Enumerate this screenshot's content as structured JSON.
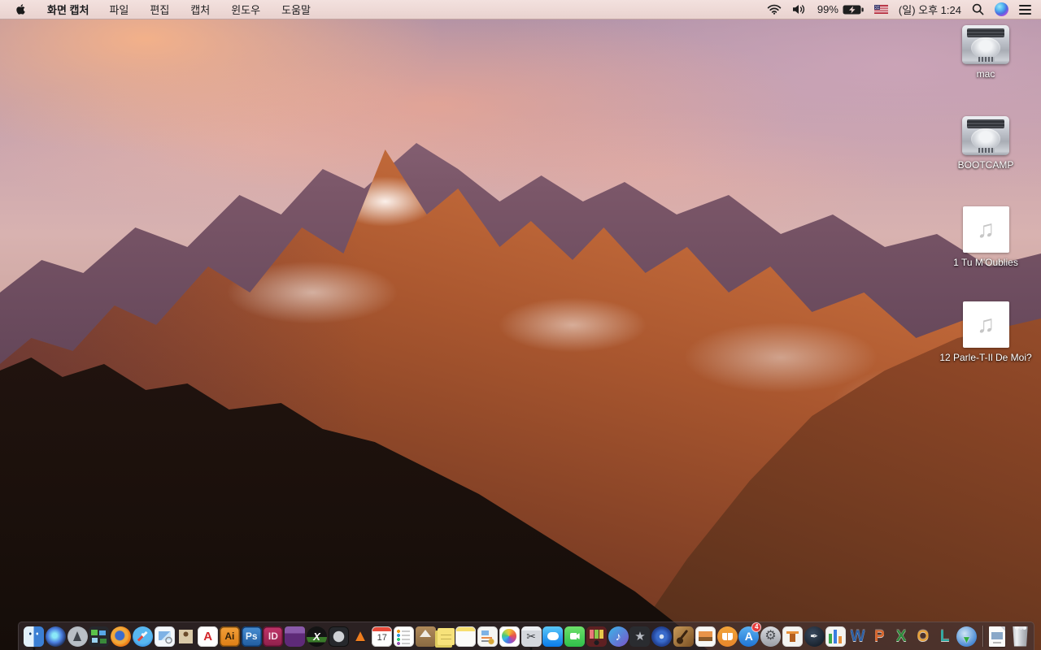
{
  "menubar": {
    "apple_icon": "apple-logo",
    "app_menu": "화면 캡처",
    "menus": [
      "파일",
      "편집",
      "캡처",
      "윈도우",
      "도움말"
    ],
    "status": {
      "wifi_icon": "wifi",
      "volume_icon": "volume",
      "battery_percent": "99%",
      "battery_icon": "battery-charging",
      "input_flag_icon": "us-flag",
      "clock": "(일) 오후 1:24",
      "search_icon": "spotlight-search",
      "siri_icon": "siri",
      "notification_icon": "notification-center"
    }
  },
  "desktop": {
    "icons": [
      {
        "label": "mac",
        "type": "hard-drive"
      },
      {
        "label": "BOOTCAMP",
        "type": "hard-drive"
      },
      {
        "label": "1 Tu M'Oublies",
        "type": "audio-file",
        "glyph": "♫"
      },
      {
        "label": "12 Parle-T-Il De Moi?",
        "type": "audio-file",
        "glyph": "♫"
      }
    ]
  },
  "dock": {
    "items": [
      {
        "name": "finder",
        "running": true
      },
      {
        "name": "siri"
      },
      {
        "name": "launchpad"
      },
      {
        "name": "mission-control"
      },
      {
        "name": "firefox"
      },
      {
        "name": "safari"
      },
      {
        "name": "preview"
      },
      {
        "name": "contacts"
      },
      {
        "name": "acrobat-reader",
        "glyph": "A"
      },
      {
        "name": "illustrator",
        "glyph": "Ai"
      },
      {
        "name": "photoshop",
        "glyph": "Ps"
      },
      {
        "name": "indesign",
        "glyph": "ID"
      },
      {
        "name": "toast"
      },
      {
        "name": "xld",
        "glyph": "X"
      },
      {
        "name": "aperture"
      },
      {
        "name": "vlc",
        "glyph": "▲"
      },
      {
        "name": "calendar",
        "glyph": "17"
      },
      {
        "name": "reminders"
      },
      {
        "name": "stuffit-expander"
      },
      {
        "name": "stickies"
      },
      {
        "name": "notes"
      },
      {
        "name": "installer"
      },
      {
        "name": "photos"
      },
      {
        "name": "grab",
        "glyph": "✂",
        "running": true
      },
      {
        "name": "messages"
      },
      {
        "name": "facetime"
      },
      {
        "name": "photo-booth"
      },
      {
        "name": "itunes",
        "glyph": "♪"
      },
      {
        "name": "imovie",
        "glyph": "★"
      },
      {
        "name": "idvd"
      },
      {
        "name": "garageband"
      },
      {
        "name": "iphoto"
      },
      {
        "name": "ibooks"
      },
      {
        "name": "app-store",
        "glyph": "A",
        "badge": "4"
      },
      {
        "name": "system-preferences",
        "glyph": "⚙"
      },
      {
        "name": "keynote"
      },
      {
        "name": "pages",
        "glyph": "✒"
      },
      {
        "name": "numbers"
      },
      {
        "name": "word",
        "glyph": "W"
      },
      {
        "name": "powerpoint",
        "glyph": "P"
      },
      {
        "name": "excel",
        "glyph": "X"
      },
      {
        "name": "outlook",
        "glyph": "O"
      },
      {
        "name": "lync",
        "glyph": "L"
      },
      {
        "name": "download-manager",
        "glyph": "▼"
      }
    ],
    "files": [
      {
        "name": "image-file"
      },
      {
        "name": "trash"
      }
    ]
  },
  "colors": {
    "menubar_tint": "#eedad6",
    "dock_tint": "#3a3136",
    "badge_red": "#e83b3a",
    "desktop_label_text": "#ffffff"
  }
}
